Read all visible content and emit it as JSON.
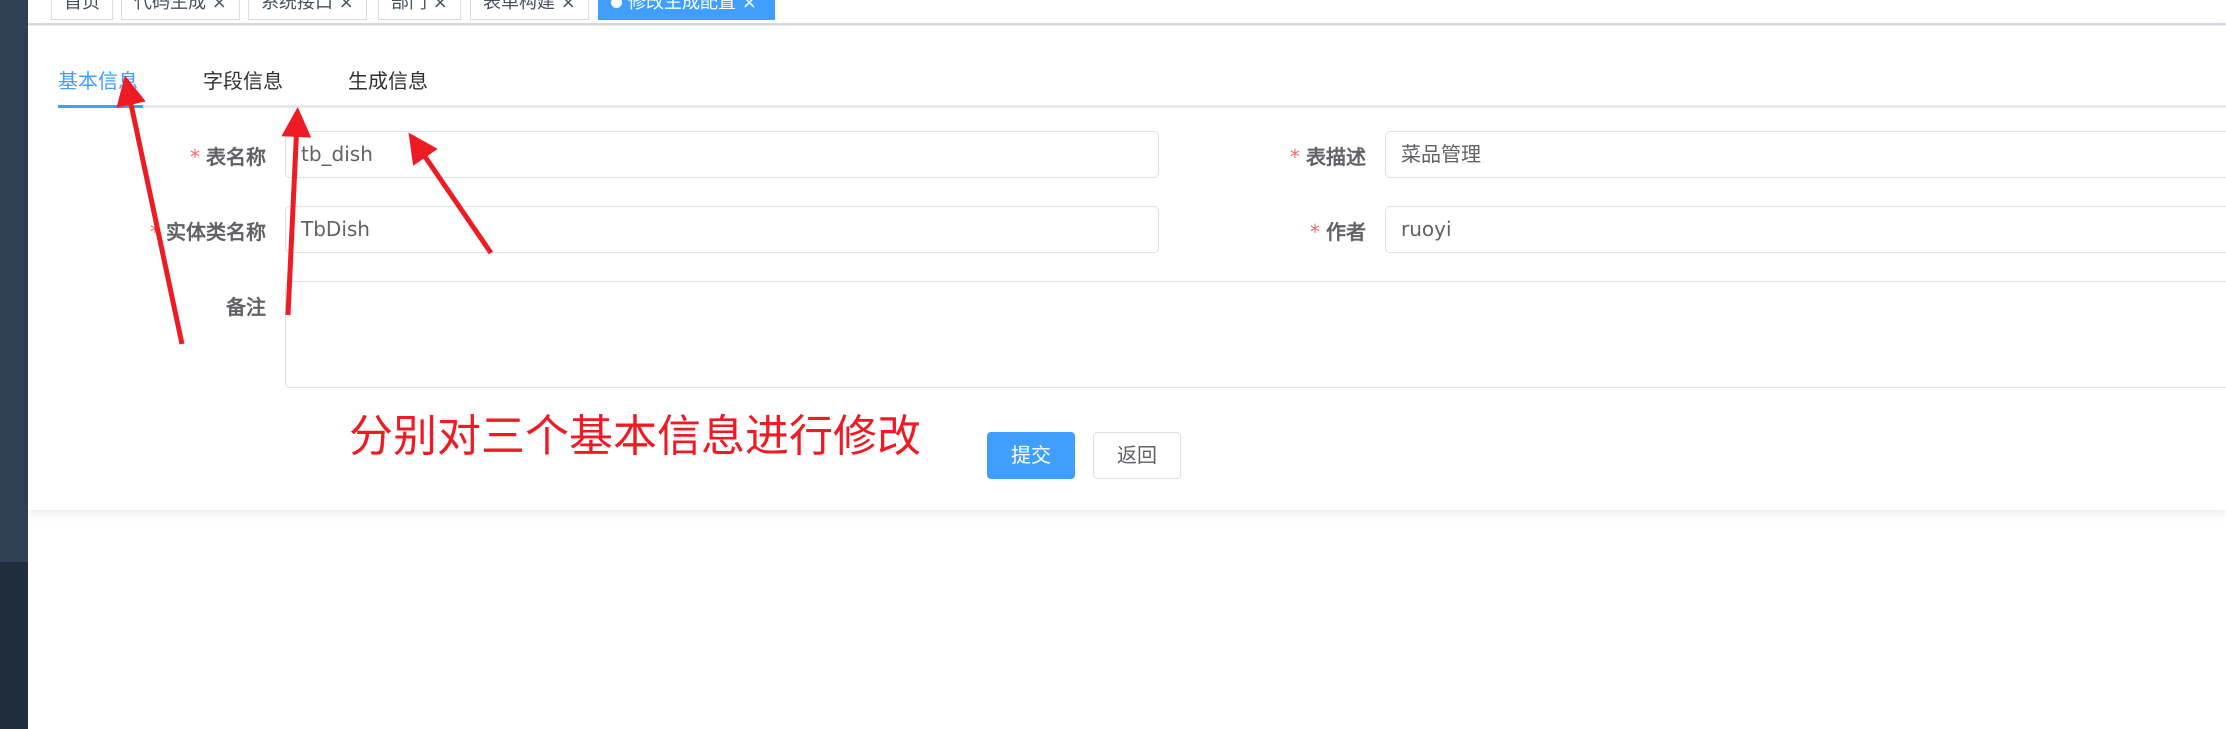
{
  "tags": [
    {
      "label": "首页",
      "closable": false
    },
    {
      "label": "代码生成 ×",
      "closable": true
    },
    {
      "label": "系统接口 ×",
      "closable": true
    },
    {
      "label": "部门 ×",
      "closable": true
    },
    {
      "label": "表单构建 ×",
      "closable": true
    },
    {
      "label": "修改生成配置 ×",
      "closable": true,
      "active": true
    }
  ],
  "tabs": [
    {
      "label": "基本信息",
      "active": true
    },
    {
      "label": "字段信息"
    },
    {
      "label": "生成信息"
    }
  ],
  "form": {
    "table_name": {
      "label": "表名称",
      "required": "*",
      "value": "tb_dish"
    },
    "table_comment": {
      "label": "表描述",
      "required": "*",
      "value": "菜品管理"
    },
    "class_name": {
      "label": "实体类名称",
      "required": "*",
      "value": "TbDish"
    },
    "author": {
      "label": "作者",
      "required": "*",
      "value": "ruoyi"
    },
    "remark": {
      "label": "备注",
      "value": ""
    }
  },
  "buttons": {
    "submit": "提交",
    "back": "返回"
  },
  "annotation": {
    "text": "分别对三个基本信息进行修改",
    "color": "#ed1c24"
  },
  "colors": {
    "accent": "#409eff",
    "sidebar": "#304156",
    "required": "#f56c6c"
  }
}
